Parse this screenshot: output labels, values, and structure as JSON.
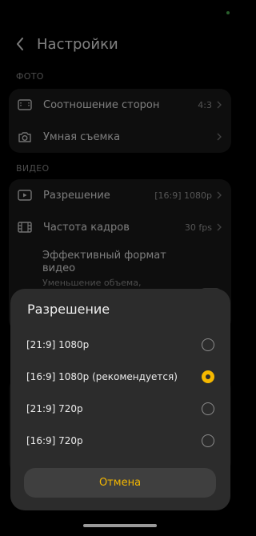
{
  "header": {
    "title": "Настройки"
  },
  "sections": {
    "photo": {
      "label": "ФОТО",
      "items": [
        {
          "label": "Соотношение сторон",
          "value": "4:3",
          "icon": "aspect-ratio-icon"
        },
        {
          "label": "Умная съемка",
          "value": "",
          "icon": "camera-icon"
        }
      ]
    },
    "video": {
      "label": "ВИДЕО",
      "items": [
        {
          "label": "Разрешение",
          "value": "[16:9] 1080p",
          "icon": "video-resolution-icon"
        },
        {
          "label": "Частота кадров",
          "value": "30 fps",
          "icon": "film-icon"
        },
        {
          "label": "Эффективный формат видео",
          "sublabel": "Уменьшение объема,"
        }
      ]
    }
  },
  "dialog": {
    "title": "Разрешение",
    "options": [
      {
        "label": "[21:9] 1080p",
        "selected": false
      },
      {
        "label": "[16:9] 1080p (рекомендуется)",
        "selected": true
      },
      {
        "label": "[21:9] 720p",
        "selected": false
      },
      {
        "label": "[16:9] 720p",
        "selected": false
      }
    ],
    "cancel_label": "Отмена"
  },
  "colors": {
    "accent": "#f5b800",
    "background": "#000000",
    "card": "#1b1b1b",
    "sheet": "#2c2c2c"
  }
}
